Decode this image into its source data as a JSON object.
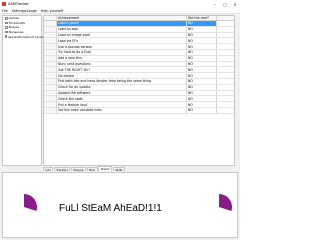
{
  "window": {
    "title": "SAMTracker"
  },
  "menu": [
    "File",
    "Settings/Langs",
    "Help yourself"
  ],
  "tree": [
    "Games",
    "Thresholds",
    "Bosses",
    "Nonsense",
    "Applications/built (docs)"
  ],
  "grid": {
    "columns": [
      "Achievement",
      "Did the rear?"
    ],
    "rows": [
      {
        "name": "Load a game",
        "value": "NO",
        "selected": true
      },
      {
        "name": "Load an app",
        "value": "NO",
        "selected": false
      },
      {
        "name": "Load an image pack",
        "value": "NO",
        "selected": false
      },
      {
        "name": "Load via EFx",
        "value": "NO",
        "selected": false
      },
      {
        "name": "Use a pseudo version",
        "value": "NO",
        "selected": false
      },
      {
        "name": "Try hard to do a Dud",
        "value": "NO",
        "selected": false
      },
      {
        "name": "Add a new thru",
        "value": "NO",
        "selected": false
      },
      {
        "name": "Nunc sent questions",
        "value": "NO",
        "selected": false
      },
      {
        "name": "Got THE RIGHT ’ttt’!",
        "value": "NO",
        "selected": false
      },
      {
        "name": "Ob-trolled",
        "value": "NO",
        "selected": false
      },
      {
        "name": "Fink both idle and have Ampler time being the same thing",
        "value": "NO",
        "selected": false
      },
      {
        "name": "Check for an update",
        "value": "NO",
        "selected": false
      },
      {
        "name": "Update the software",
        "value": "NO",
        "selected": false
      },
      {
        "name": "Check the stats",
        "value": "NO",
        "selected": false
      },
      {
        "name": "Pull a feature loud",
        "value": "NO",
        "selected": false
      },
      {
        "name": "Set the more valuable links",
        "value": "NO",
        "selected": false
      }
    ]
  },
  "tabs": [
    {
      "label": "Info",
      "active": false
    },
    {
      "label": "Trackers",
      "active": false
    },
    {
      "label": "Players",
      "active": false
    },
    {
      "label": "Misc",
      "active": false
    },
    {
      "label": "Steam",
      "active": true
    },
    {
      "label": "Stats",
      "active": false
    }
  ],
  "banner": {
    "text": "FuLl StEaM AhEaD!1!1"
  },
  "progress": {
    "left": 0.3,
    "right": 0.3,
    "color": "#8b1a8b"
  }
}
